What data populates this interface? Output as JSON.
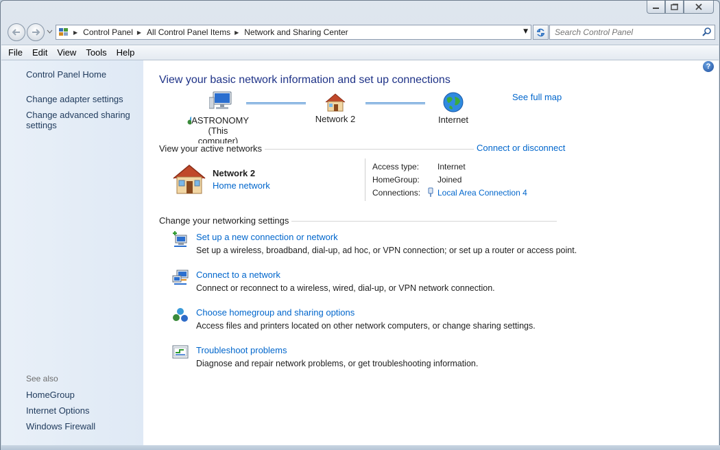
{
  "window": {
    "controls": [
      "minimize-icon",
      "maximize-icon",
      "close-icon"
    ]
  },
  "address": {
    "crumbs": [
      "Control Panel",
      "All Control Panel Items",
      "Network and Sharing Center"
    ],
    "search_placeholder": "Search Control Panel"
  },
  "menu": [
    "File",
    "Edit",
    "View",
    "Tools",
    "Help"
  ],
  "sidebar": {
    "home": "Control Panel Home",
    "adapter": "Change adapter settings",
    "advanced_1": "Change advanced sharing",
    "advanced_2": "settings",
    "see_also": "See also",
    "see_also_items": [
      "HomeGroup",
      "Internet Options",
      "Windows Firewall"
    ]
  },
  "main": {
    "title": "View your basic network information and set up connections",
    "see_full_map": "See full map",
    "map": {
      "computer_name": "ASTRONOMY",
      "computer_sub": "(This computer)",
      "network": "Network  2",
      "internet": "Internet"
    },
    "active_networks": {
      "label": "View your active networks",
      "connect_link": "Connect or disconnect",
      "network_name": "Network  2",
      "network_type": "Home network",
      "props": [
        {
          "label": "Access type:",
          "value": "Internet"
        },
        {
          "label": "HomeGroup:",
          "value": "Joined"
        },
        {
          "label": "Connections:",
          "value": "Local Area Connection 4"
        }
      ]
    },
    "settings": {
      "label": "Change your networking settings",
      "tasks": [
        {
          "title": "Set up a new connection or network",
          "desc": "Set up a wireless, broadband, dial-up, ad hoc, or VPN connection; or set up a router or access point."
        },
        {
          "title": "Connect to a network",
          "desc": "Connect or reconnect to a wireless, wired, dial-up, or VPN network connection."
        },
        {
          "title": "Choose homegroup and sharing options",
          "desc": "Access files and printers located on other network computers, or change sharing settings."
        },
        {
          "title": "Troubleshoot problems",
          "desc": "Diagnose and repair network problems, or get troubleshooting information."
        }
      ]
    }
  }
}
